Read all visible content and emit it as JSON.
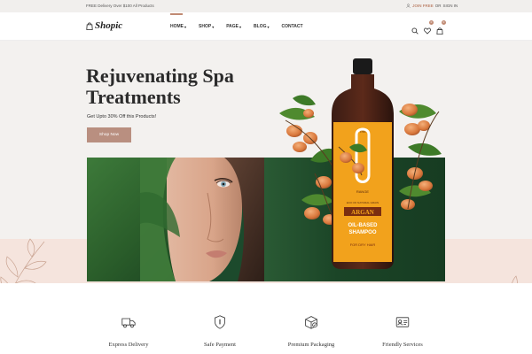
{
  "topbar": {
    "promo": "FREE Delivery Over $100 All Products",
    "join_label": "JOIN FREE",
    "or_label": "OR",
    "signin_label": "SIGN IN"
  },
  "header": {
    "logo_text": "Shopic",
    "nav": [
      {
        "label": "HOME",
        "caret": "▾",
        "active": true
      },
      {
        "label": "SHOP",
        "caret": "▾"
      },
      {
        "label": "PAGE",
        "caret": "▾"
      },
      {
        "label": "BLOG",
        "caret": "▾"
      },
      {
        "label": "CONTACT",
        "caret": ""
      }
    ],
    "wishlist_count": "0",
    "cart_count": "0"
  },
  "hero": {
    "title_line1": "Rejuvenating Spa",
    "title_line2": "Treatments",
    "subtitle": "Get Upto 30% Off this Products!",
    "button_label": "Shop Now"
  },
  "product": {
    "label_the": "THE",
    "label_range": "RANGE",
    "label_small": "ECO OF NATURAL GRAIN",
    "label_name": "ARGAN",
    "label_type1": "OIL-BASED",
    "label_type2": "SHAMPOO",
    "label_for": "FOR DRY HAIR"
  },
  "features": [
    {
      "label": "Express Delivery",
      "icon": "truck-icon"
    },
    {
      "label": "Safe Payment",
      "icon": "shield-icon"
    },
    {
      "label": "Premium Packaging",
      "icon": "package-icon"
    },
    {
      "label": "Friendly Services",
      "icon": "id-card-icon"
    }
  ],
  "colors": {
    "accent": "#c08a73",
    "button": "#b98f80",
    "banner_green": "#1c4a2c",
    "lower_pink": "#f5e4dd",
    "bottle_label": "#f2a21c"
  }
}
